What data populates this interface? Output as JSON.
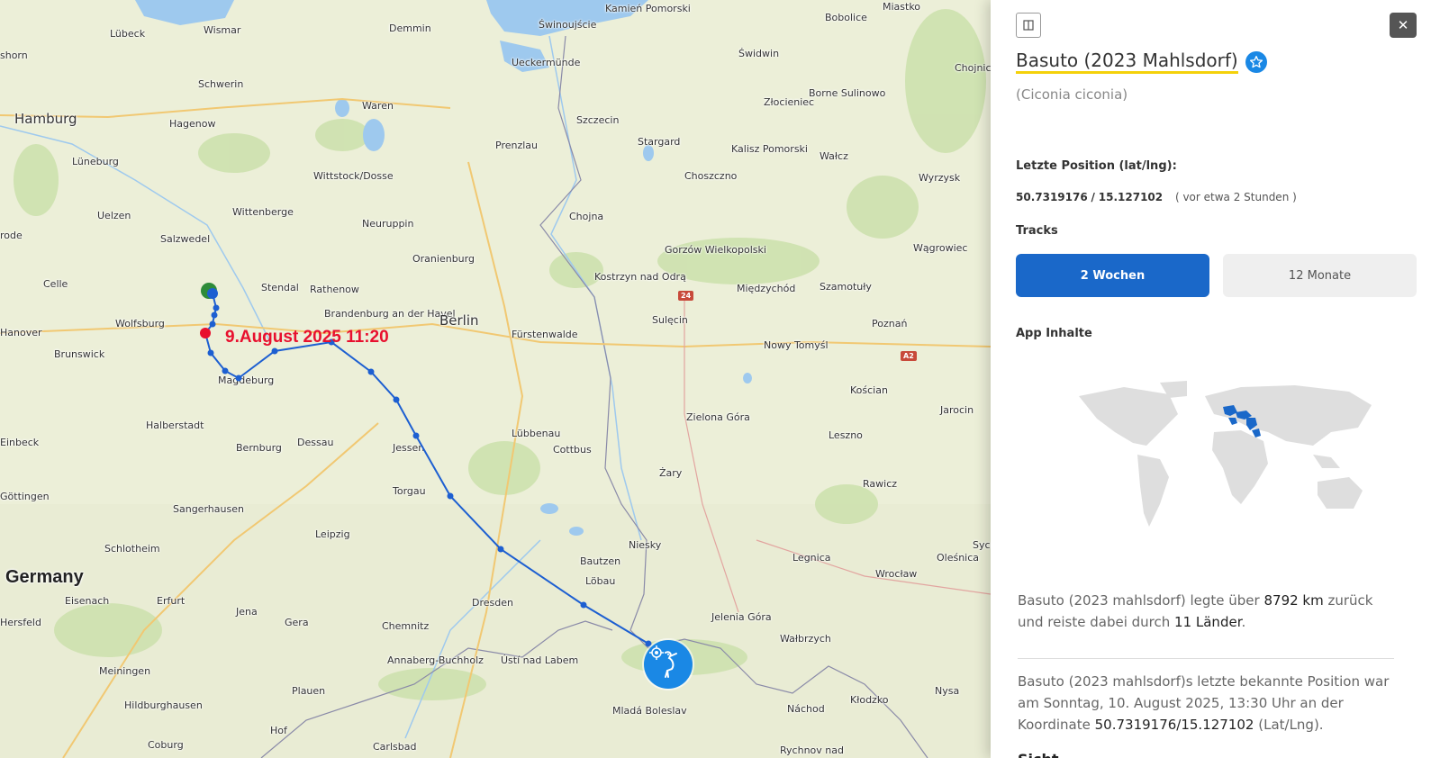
{
  "map": {
    "date_label": "9.August 2025 11:20",
    "colors": {
      "track": "#1d5fd1",
      "marker": "#1a88e5",
      "start": "#2e8b3a",
      "end": "#e8102e"
    },
    "cities": [
      {
        "name": "Lübeck",
        "size": "normal"
      },
      {
        "name": "Wismar",
        "size": "normal"
      },
      {
        "name": "Demmin",
        "size": "normal"
      },
      {
        "name": "Świnoujście",
        "size": "normal"
      },
      {
        "name": "Kamień Pomorski",
        "size": "normal"
      },
      {
        "name": "Bobolice",
        "size": "normal"
      },
      {
        "name": "Miastko",
        "size": "normal"
      },
      {
        "name": "Hamburg",
        "size": "big"
      },
      {
        "name": "Schwerin",
        "size": "normal"
      },
      {
        "name": "Ueckermünde",
        "size": "normal"
      },
      {
        "name": "Świdwin",
        "size": "normal"
      },
      {
        "name": "Chojnice",
        "size": "normal"
      },
      {
        "name": "Waren",
        "size": "normal"
      },
      {
        "name": "Szczecin",
        "size": "normal"
      },
      {
        "name": "Borne Sulinowo",
        "size": "normal"
      },
      {
        "name": "Hagenow",
        "size": "normal"
      },
      {
        "name": "Złocieniec",
        "size": "normal"
      },
      {
        "name": "Stargard",
        "size": "normal"
      },
      {
        "name": "Prenzlau",
        "size": "normal"
      },
      {
        "name": "Lüneburg",
        "size": "normal"
      },
      {
        "name": "Kalisz Pomorski",
        "size": "normal"
      },
      {
        "name": "Wałcz",
        "size": "normal"
      },
      {
        "name": "Wittstock/Dosse",
        "size": "normal"
      },
      {
        "name": "Choszczno",
        "size": "normal"
      },
      {
        "name": "Wyrzysk",
        "size": "normal"
      },
      {
        "name": "Uelzen",
        "size": "normal"
      },
      {
        "name": "Wittenberge",
        "size": "normal"
      },
      {
        "name": "Chojna",
        "size": "normal"
      },
      {
        "name": "Neuruppin",
        "size": "normal"
      },
      {
        "name": "Salzwedel",
        "size": "normal"
      },
      {
        "name": "Gorzów Wielkopolski",
        "size": "normal"
      },
      {
        "name": "Wągrowiec",
        "size": "normal"
      },
      {
        "name": "Oranienburg",
        "size": "normal"
      },
      {
        "name": "Celle",
        "size": "normal"
      },
      {
        "name": "Stendal",
        "size": "normal"
      },
      {
        "name": "Rathenow",
        "size": "normal"
      },
      {
        "name": "Kostrzyn nad Odrą",
        "size": "normal"
      },
      {
        "name": "Międzychód",
        "size": "normal"
      },
      {
        "name": "Szamotuły",
        "size": "normal"
      },
      {
        "name": "Wolfsburg",
        "size": "normal"
      },
      {
        "name": "Brandenburg an der Havel",
        "size": "normal"
      },
      {
        "name": "Berlin",
        "size": "big"
      },
      {
        "name": "Sulęcin",
        "size": "normal"
      },
      {
        "name": "Poznań",
        "size": "normal"
      },
      {
        "name": "Hanover",
        "size": "normal"
      },
      {
        "name": "Fürstenwalde",
        "size": "normal"
      },
      {
        "name": "Nowy Tomyśl",
        "size": "normal"
      },
      {
        "name": "Brunswick",
        "size": "normal"
      },
      {
        "name": "Magdeburg",
        "size": "normal"
      },
      {
        "name": "Kościan",
        "size": "normal"
      },
      {
        "name": "Halberstadt",
        "size": "normal"
      },
      {
        "name": "Zielona Góra",
        "size": "normal"
      },
      {
        "name": "Jarocin",
        "size": "normal"
      },
      {
        "name": "Lübbenau",
        "size": "normal"
      },
      {
        "name": "Einbeck",
        "size": "normal"
      },
      {
        "name": "Dessau",
        "size": "normal"
      },
      {
        "name": "Bernburg",
        "size": "normal"
      },
      {
        "name": "Jessen",
        "size": "normal"
      },
      {
        "name": "Cottbus",
        "size": "normal"
      },
      {
        "name": "Leszno",
        "size": "normal"
      },
      {
        "name": "Żary",
        "size": "normal"
      },
      {
        "name": "Göttingen",
        "size": "normal"
      },
      {
        "name": "Torgau",
        "size": "normal"
      },
      {
        "name": "Rawicz",
        "size": "normal"
      },
      {
        "name": "Sangerhausen",
        "size": "normal"
      },
      {
        "name": "Leipzig",
        "size": "normal"
      },
      {
        "name": "Niesky",
        "size": "normal"
      },
      {
        "name": "Schlotheim",
        "size": "normal"
      },
      {
        "name": "Bautzen",
        "size": "normal"
      },
      {
        "name": "Legnica",
        "size": "normal"
      },
      {
        "name": "Oleśnica",
        "size": "normal"
      },
      {
        "name": "Germany",
        "size": "country"
      },
      {
        "name": "Löbau",
        "size": "normal"
      },
      {
        "name": "Wrocław",
        "size": "normal"
      },
      {
        "name": "Eisenach",
        "size": "normal"
      },
      {
        "name": "Erfurt",
        "size": "normal"
      },
      {
        "name": "Dresden",
        "size": "normal"
      },
      {
        "name": "Jena",
        "size": "normal"
      },
      {
        "name": "Jelenia Góra",
        "size": "normal"
      },
      {
        "name": "Hersfeld",
        "size": "normal"
      },
      {
        "name": "Gera",
        "size": "normal"
      },
      {
        "name": "Chemnitz",
        "size": "normal"
      },
      {
        "name": "Wałbrzych",
        "size": "normal"
      },
      {
        "name": "Ústí nad Labem",
        "size": "normal"
      },
      {
        "name": "Meiningen",
        "size": "normal"
      },
      {
        "name": "Annaberg-Buchholz",
        "size": "normal"
      },
      {
        "name": "Plauen",
        "size": "normal"
      },
      {
        "name": "Nysa",
        "size": "normal"
      },
      {
        "name": "Hildburghausen",
        "size": "normal"
      },
      {
        "name": "Kłodzko",
        "size": "normal"
      },
      {
        "name": "Náchod",
        "size": "normal"
      },
      {
        "name": "Mladá Boleslav",
        "size": "normal"
      },
      {
        "name": "Hof",
        "size": "normal"
      },
      {
        "name": "Coburg",
        "size": "normal"
      },
      {
        "name": "Carlsbad",
        "size": "normal"
      },
      {
        "name": "Rychnov nad",
        "size": "normal"
      },
      {
        "name": "Sycó",
        "size": "normal"
      },
      {
        "name": "shorn",
        "size": "normal"
      },
      {
        "name": "rode",
        "size": "normal"
      }
    ],
    "road_shields": [
      "24",
      "A2"
    ]
  },
  "panel": {
    "bird_name": "Basuto (2023 Mahlsdorf)",
    "species": "(Ciconia ciconia)",
    "last_position_label": "Letzte Position (lat/lng):",
    "lat": "50.7319176",
    "separator": "/",
    "lng": "15.127102",
    "ago": "( vor etwa 2 Stunden )",
    "tracks_label": "Tracks",
    "tabs": [
      {
        "label": "2 Wochen",
        "active": true
      },
      {
        "label": "12 Monate",
        "active": false
      }
    ],
    "app_content_label": "App Inhalte",
    "summary1": {
      "pre": "Basuto (2023 mahlsdorf) legte über ",
      "km": "8792 km",
      "mid": " zurück und reiste dabei durch ",
      "countries": "11 Länder",
      "post": "."
    },
    "summary2": {
      "pre": "Basuto (2023 mahlsdorf)s letzte bekannte Position war am Sonntag, 10. August 2025, 13:30 Uhr an der Koordinate ",
      "coord": "50.7319176/15.127102",
      "post": " (Lat/Lng)."
    },
    "cut_heading": "Sicht"
  }
}
